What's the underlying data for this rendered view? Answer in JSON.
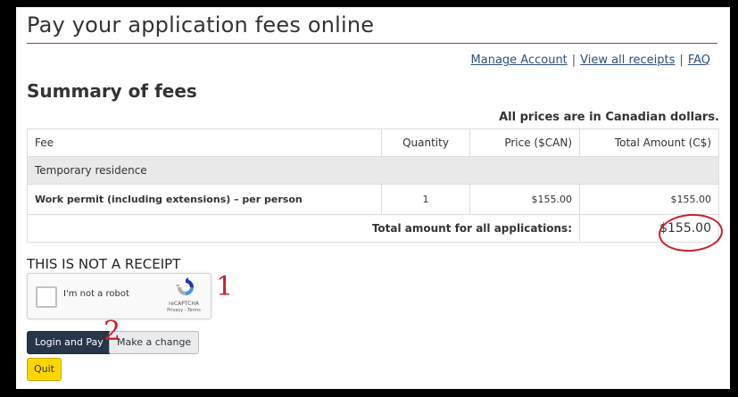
{
  "page": {
    "title": "Pay your application fees online",
    "links": {
      "manage_account": "Manage Account",
      "view_receipts": "View all receipts",
      "faq": "FAQ",
      "separator": "|"
    },
    "summary_heading": "Summary of fees",
    "currency_note": "All prices are in Canadian dollars."
  },
  "table": {
    "headers": {
      "fee": "Fee",
      "quantity": "Quantity",
      "price": "Price ($CAN)",
      "total": "Total Amount (C$)"
    },
    "category": "Temporary residence",
    "item": {
      "name": "Work permit (including extensions) – per person",
      "quantity": "1",
      "price": "$155.00",
      "total": "$155.00"
    },
    "total_label": "Total amount for all applications:",
    "total_value": "$155.00"
  },
  "not_receipt": "THIS IS NOT A RECEIPT",
  "captcha": {
    "label": "I'm not a robot",
    "brand": "reCAPTCHA",
    "terms": "Privacy - Terms",
    "icon": "recaptcha-icon"
  },
  "annotations": {
    "mark_1": "1",
    "mark_2": "2",
    "color": "#c8202c"
  },
  "buttons": {
    "login_pay": "Login and Pay",
    "make_change": "Make a change",
    "quit": "Quit"
  },
  "colors": {
    "primary_button": "#26374a",
    "quit_button": "#ffd700",
    "link": "#2b4f7a",
    "title_rule": "#9e3b3b"
  }
}
